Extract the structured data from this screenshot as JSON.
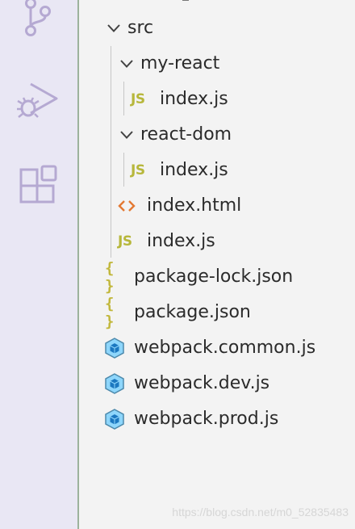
{
  "explorer": {
    "items": [
      {
        "label": "src",
        "type": "folder",
        "expanded": true
      },
      {
        "label": "my-react",
        "type": "folder",
        "expanded": true
      },
      {
        "label": "index.js",
        "type": "js",
        "icon_text": "JS"
      },
      {
        "label": "react-dom",
        "type": "folder",
        "expanded": true
      },
      {
        "label": "index.js",
        "type": "js",
        "icon_text": "JS"
      },
      {
        "label": "index.html",
        "type": "html"
      },
      {
        "label": "index.js",
        "type": "js",
        "icon_text": "JS"
      },
      {
        "label": "package-lock.json",
        "type": "json",
        "icon_text": "{ }"
      },
      {
        "label": "package.json",
        "type": "json",
        "icon_text": "{ }"
      },
      {
        "label": "webpack.common.js",
        "type": "webpack"
      },
      {
        "label": "webpack.dev.js",
        "type": "webpack"
      },
      {
        "label": "webpack.prod.js",
        "type": "webpack"
      }
    ]
  },
  "activity_bar": {
    "icons": [
      "source-control-icon",
      "run-debug-icon",
      "extensions-icon"
    ],
    "icon_color": "#b5a9d2"
  },
  "colors": {
    "js": "#b7b73b",
    "json": "#c2b83d",
    "html": "#e37933",
    "webpack": "#4d8aac"
  },
  "watermark": "https://blog.csdn.net/m0_52835483"
}
